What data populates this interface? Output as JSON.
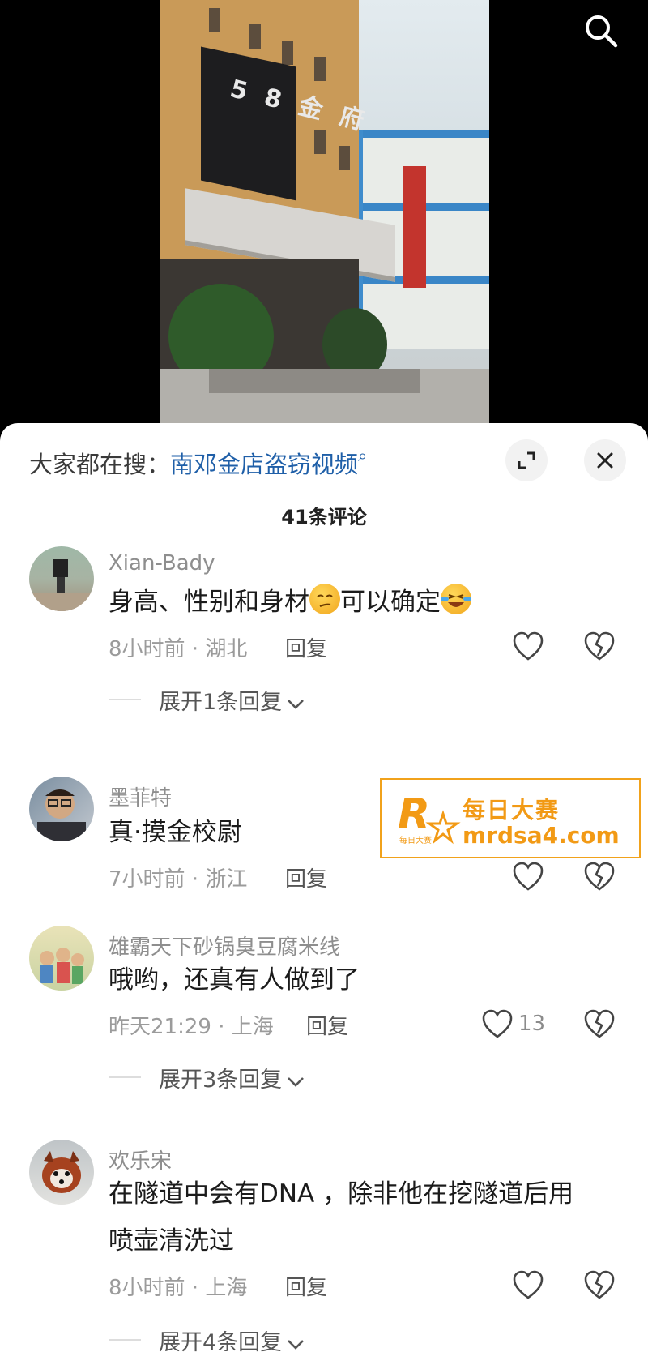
{
  "video": {
    "storefront_sign": "5 8 金 府"
  },
  "sheet": {
    "search_prefix": "大家都在搜：",
    "search_term": "南邓金店盗窃视频",
    "comment_count": "41条评论"
  },
  "comments": [
    {
      "user": "Xian-Bady",
      "text_before": "身高、性别和身材",
      "text_middle": "可以确定",
      "time_location": "8小时前 · 湖北",
      "reply": "回复",
      "likes": "",
      "expand": "展开1条回复"
    },
    {
      "user": "墨菲特",
      "text": "真·摸金校尉",
      "time_location": "7小时前 · 浙江",
      "reply": "回复",
      "likes": ""
    },
    {
      "user": "雄霸天下砂锅臭豆腐米线",
      "text": "哦哟，还真有人做到了",
      "time_location": "昨天21:29 · 上海",
      "reply": "回复",
      "likes": "13",
      "expand": "展开3条回复"
    },
    {
      "user": "欢乐宋",
      "text_line1": "在隧道中会有DNA ，除非他在挖隧道后用",
      "text_line2": "喷壶清洗过",
      "time_location": "8小时前 · 上海",
      "reply": "回复",
      "likes": "",
      "expand": "展开4条回复"
    }
  ],
  "watermark": {
    "title": "每日大赛",
    "url": "mrdsa4.com",
    "logo_small": "每日大赛"
  },
  "colors": {
    "link_blue": "#1f5fa8",
    "watermark_orange": "#f29a15"
  }
}
